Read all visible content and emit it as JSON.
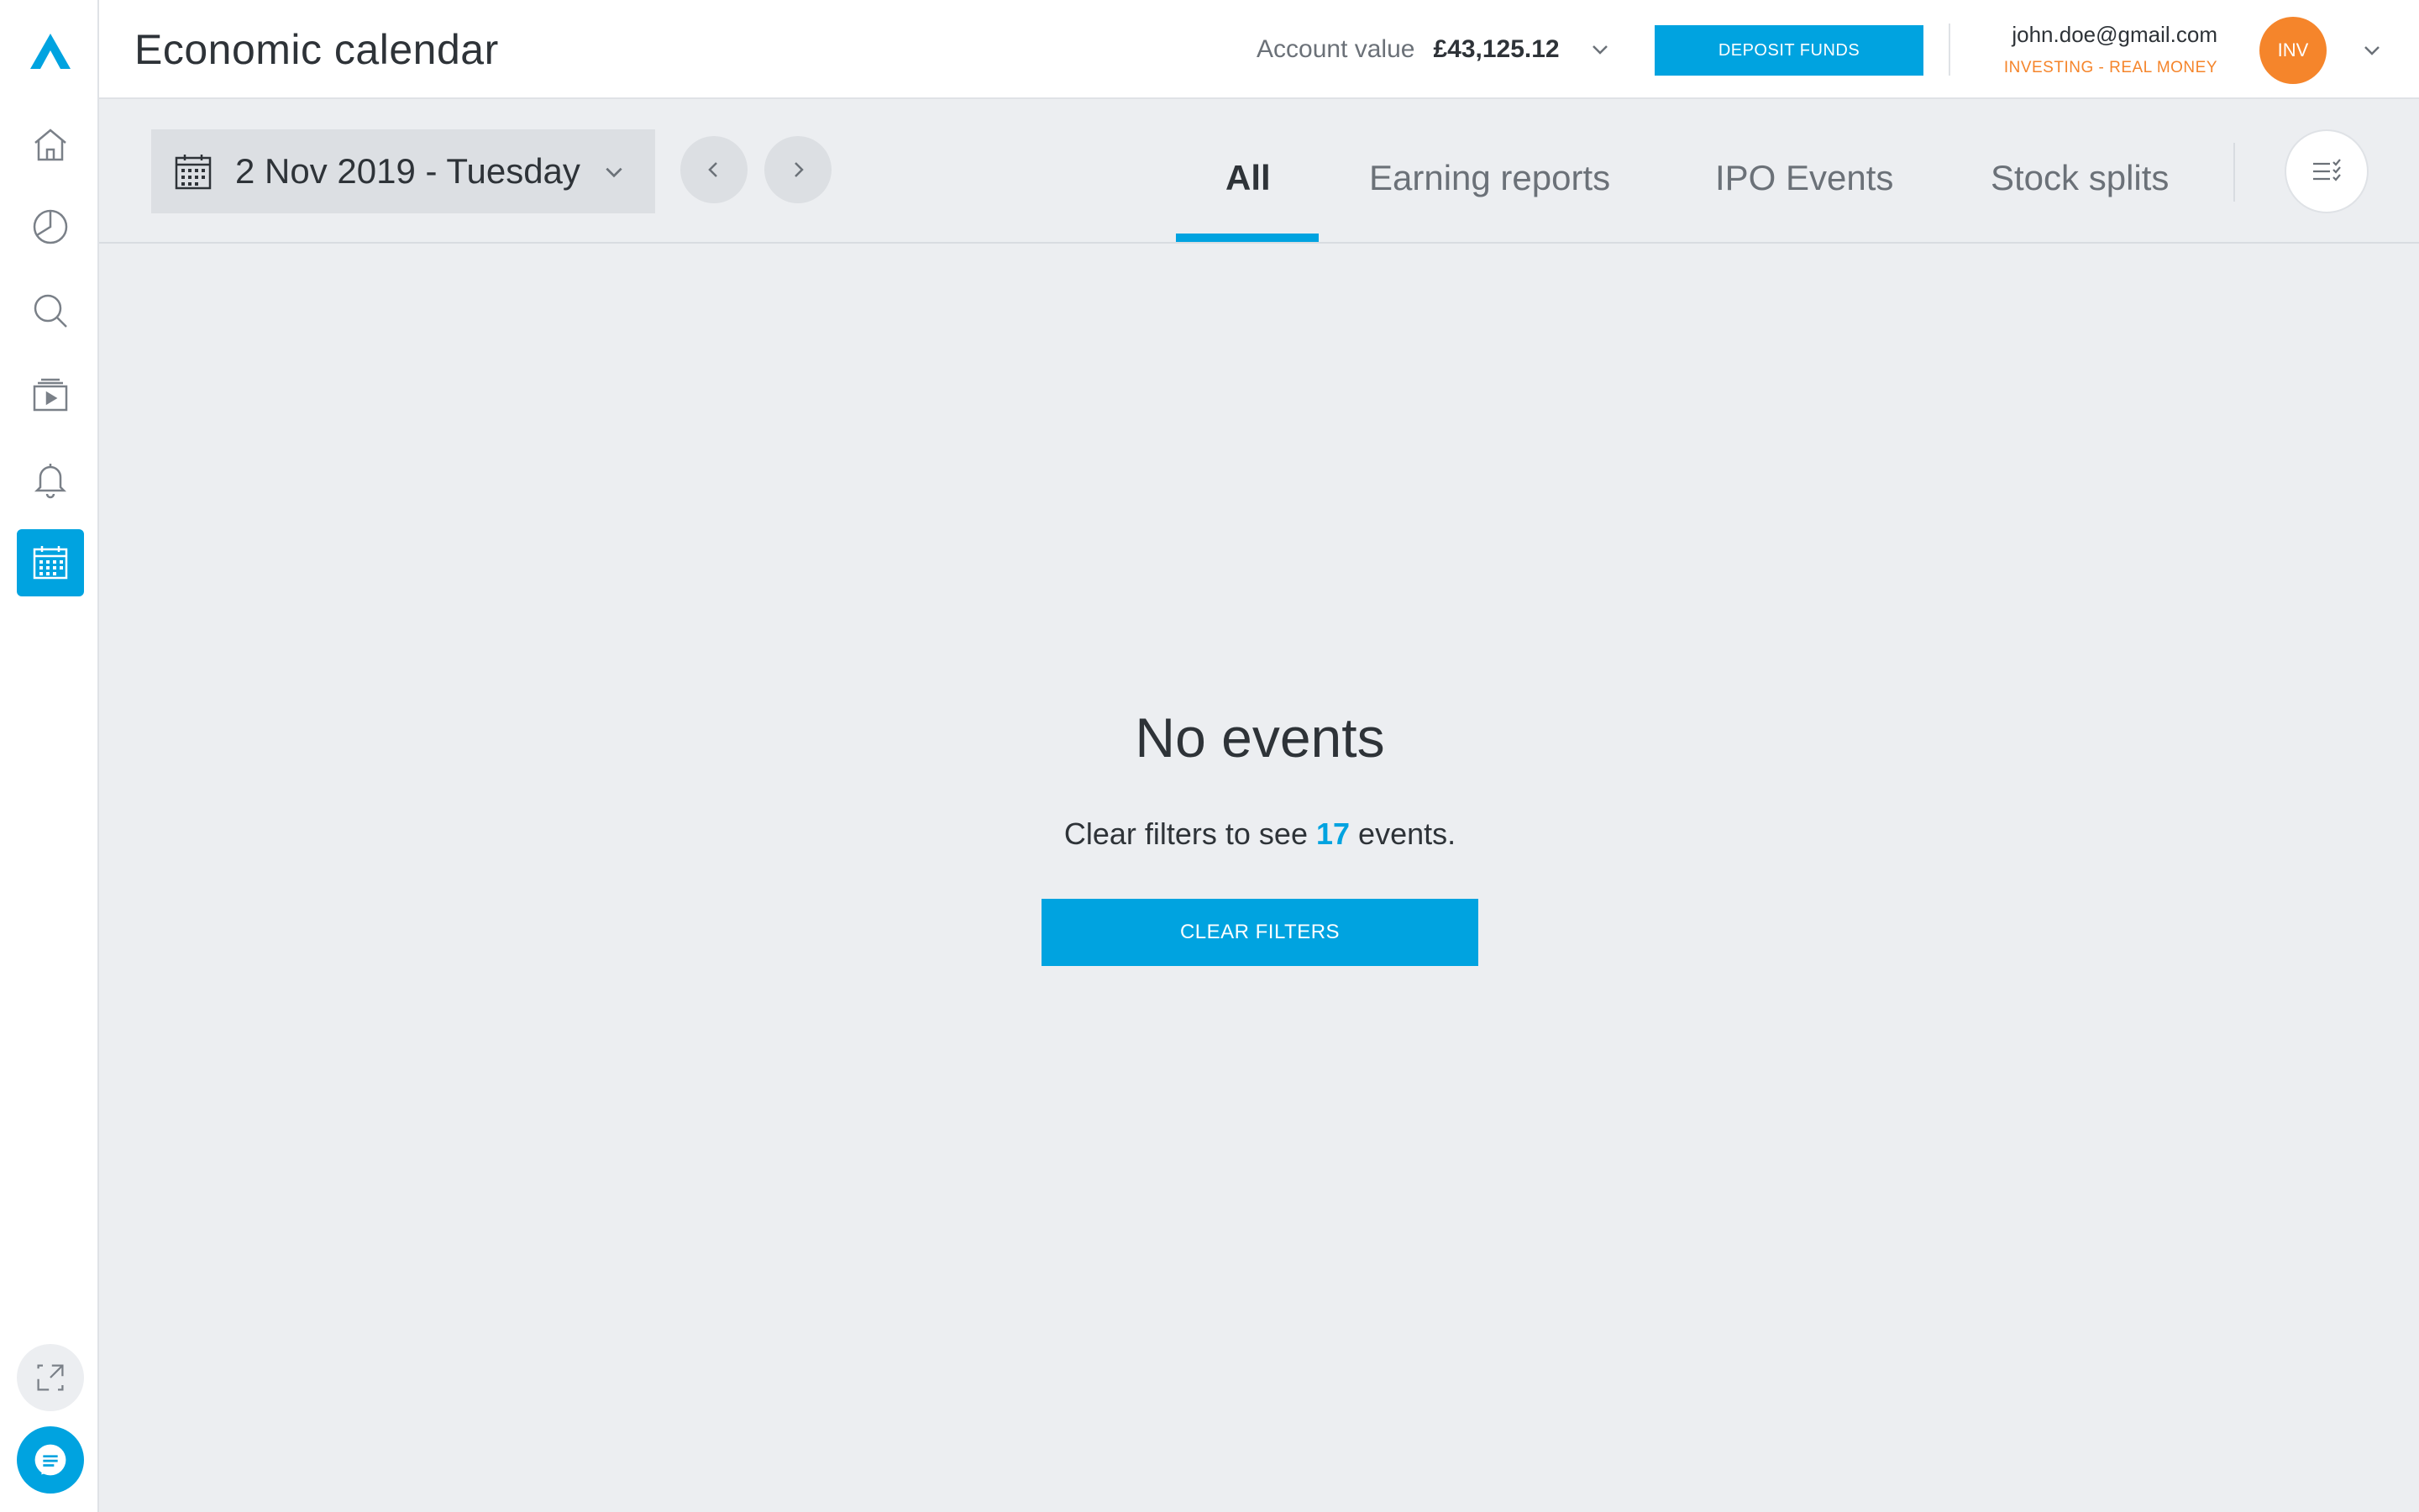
{
  "header": {
    "title": "Economic calendar",
    "account_label": "Account value",
    "account_value": "£43,125.12",
    "deposit_label": "DEPOSIT FUNDS",
    "user_email": "john.doe@gmail.com",
    "user_mode": "INVESTING - REAL MONEY",
    "avatar_initials": "INV"
  },
  "toolbar": {
    "date": "2 Nov 2019 - Tuesday",
    "tabs": [
      {
        "label": "All",
        "active": true
      },
      {
        "label": "Earning reports",
        "active": false
      },
      {
        "label": "IPO Events",
        "active": false
      },
      {
        "label": "Stock splits",
        "active": false
      }
    ]
  },
  "empty_state": {
    "title": "No events",
    "sub_prefix": "Clear filters to see",
    "count": "17",
    "sub_suffix": "events.",
    "button_label": "CLEAR FILTERS"
  },
  "sidebar": {
    "items": [
      {
        "icon": "home-icon"
      },
      {
        "icon": "pie-chart-icon"
      },
      {
        "icon": "search-icon"
      },
      {
        "icon": "video-library-icon"
      },
      {
        "icon": "bell-icon"
      },
      {
        "icon": "calendar-icon",
        "active": true
      }
    ]
  },
  "colors": {
    "accent": "#00a3e0",
    "orange": "#f5852b",
    "background": "#eceef1"
  }
}
